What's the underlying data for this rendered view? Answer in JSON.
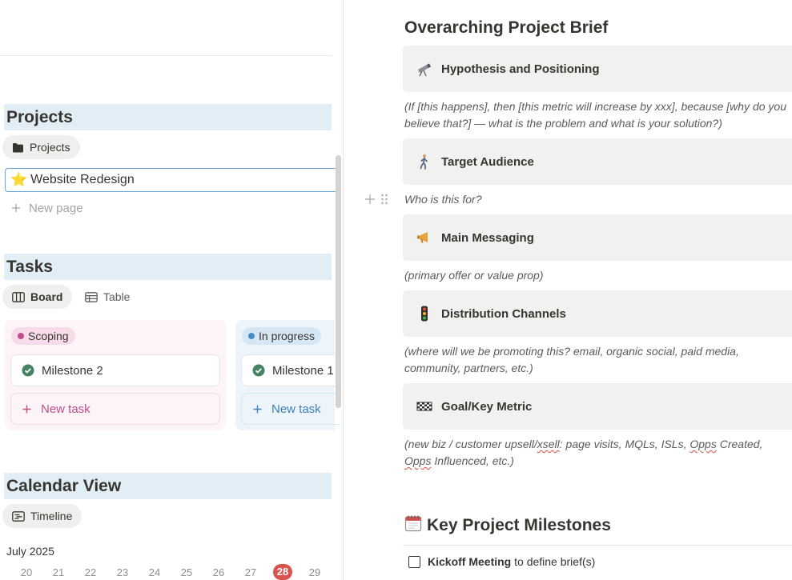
{
  "projects": {
    "header": "Projects",
    "view_chip": "Projects",
    "editing_page": {
      "emoji": "⭐",
      "title": "Website Redesign"
    },
    "new_page": "New page"
  },
  "tasks": {
    "header": "Tasks",
    "view_tabs": [
      "Board",
      "Table"
    ],
    "columns": [
      {
        "status": "Scoping",
        "color": "#c14c8a",
        "pill_bg": "#f7dbe8",
        "card": "Milestone 2",
        "new_task": "New task"
      },
      {
        "status": "In progress",
        "color": "#4a8ac5",
        "pill_bg": "#d5e7f4",
        "card": "Milestone 1",
        "new_task": "New task"
      }
    ]
  },
  "calendar": {
    "header": "Calendar View",
    "view_chip": "Timeline",
    "month": "July 2025",
    "days": [
      "20",
      "21",
      "22",
      "23",
      "24",
      "25",
      "26",
      "27",
      "28",
      "29"
    ],
    "today": "28"
  },
  "brief": {
    "title": "Overarching Project Brief",
    "sections": [
      {
        "icon": "telescope-icon",
        "heading": "Hypothesis and Positioning",
        "note": "(If [this happens], then [this metric will increase by xxx], because [why do you believe that?] — what is the problem and what is your solution?)"
      },
      {
        "icon": "person-walking-icon",
        "heading": "Target Audience",
        "note": "Who is this for?"
      },
      {
        "icon": "megaphone-icon",
        "heading": "Main Messaging",
        "note": "(primary offer or value prop)"
      },
      {
        "icon": "traffic-light-icon",
        "heading": "Distribution Channels",
        "note": "(where will we be promoting this? email, organic social, paid media, community, partners, etc.)"
      },
      {
        "icon": "checkered-flag-icon",
        "heading": "Goal/Key Metric",
        "note_parts": [
          "(new biz / customer upsell/",
          "xsell",
          ": page visits, MQLs, ISLs, ",
          "Opps",
          " Created, ",
          "Opps",
          " Influenced, etc.)"
        ]
      }
    ],
    "milestones": {
      "icon": "spiral-calendar-icon",
      "heading": "Key Project Milestones",
      "todo_bold": "Kickoff Meeting",
      "todo_rest": " to define brief(s)"
    }
  }
}
